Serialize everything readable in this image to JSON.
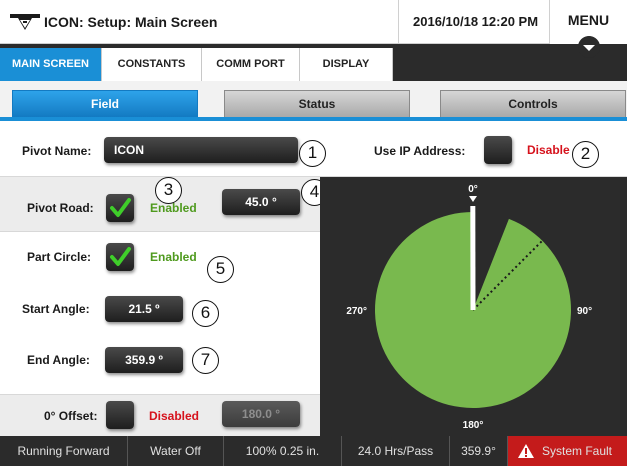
{
  "window": {
    "title": "ICON: Setup: Main Screen",
    "datetime": "2016/10/18 12:20 PM",
    "menu_label": "MENU"
  },
  "nav_tabs": [
    {
      "label": "MAIN SCREEN",
      "active": true
    },
    {
      "label": "CONSTANTS",
      "active": false
    },
    {
      "label": "COMM PORT",
      "active": false
    },
    {
      "label": "DISPLAY",
      "active": false
    }
  ],
  "sub_tabs": [
    {
      "label": "Field",
      "active": true
    },
    {
      "label": "Status",
      "active": false
    },
    {
      "label": "Controls",
      "active": false
    }
  ],
  "field": {
    "pivot_name_label": "Pivot Name:",
    "pivot_name_value": "ICON",
    "use_ip_label": "Use IP Address:",
    "use_ip_status": "Disable",
    "pivot_road_label": "Pivot Road:",
    "pivot_road_status": "Enabled",
    "pivot_road_value": "45.0 °",
    "part_circle_label": "Part Circle:",
    "part_circle_status": "Enabled",
    "start_angle_label": "Start Angle:",
    "start_angle_value": "21.5 º",
    "end_angle_label": "End Angle:",
    "end_angle_value": "359.9 º",
    "offset_label": "0° Offset:",
    "offset_status": "Disabled",
    "offset_value": "180.0 °"
  },
  "callouts": [
    "1",
    "2",
    "3",
    "4",
    "5",
    "6",
    "7"
  ],
  "pivot_diagram": {
    "label_top": "0°",
    "label_right": "90°",
    "label_bottom": "180°",
    "label_left": "270°",
    "start_angle_deg": 21.5,
    "end_angle_deg": 359.9,
    "pivot_road_deg": 45.0,
    "current_position_deg": 359.9,
    "fill_color": "#79b94e",
    "panel_color": "#2b2b2b"
  },
  "status_bar": {
    "direction": "Running Forward",
    "water": "Water Off",
    "application": "100% 0.25 in.",
    "hours_per_pass": "24.0 Hrs/Pass",
    "position": "359.9°",
    "fault": "System Fault"
  },
  "colors": {
    "accent": "#1a8fd6",
    "enabled": "#4f9a1e",
    "disabled": "#d6121c",
    "fault": "#c41b1b"
  }
}
